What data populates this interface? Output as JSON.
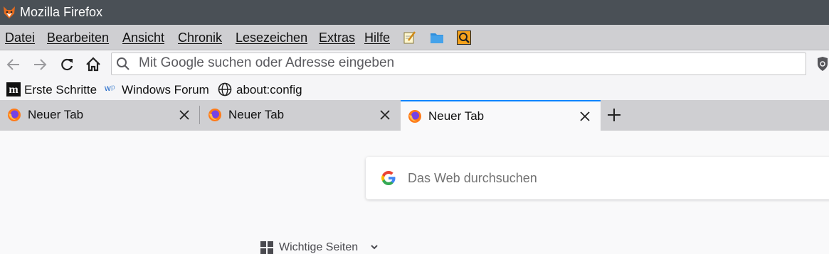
{
  "window": {
    "title": "Mozilla Firefox"
  },
  "menubar": {
    "items": [
      "Datei",
      "Bearbeiten",
      "Ansicht",
      "Chronik",
      "Lesezeichen",
      "Extras",
      "Hilfe"
    ]
  },
  "navbar": {
    "url_placeholder": "Mit Google suchen oder Adresse eingeben"
  },
  "bookmarks": [
    {
      "label": "Erste Schritte",
      "icon": "m-icon"
    },
    {
      "label": "Windows Forum",
      "icon": "wp-icon"
    },
    {
      "label": "about:config",
      "icon": "globe-icon"
    }
  ],
  "tabs": [
    {
      "label": "Neuer Tab",
      "selected": false
    },
    {
      "label": "Neuer Tab",
      "selected": false
    },
    {
      "label": "Neuer Tab",
      "selected": true
    }
  ],
  "newtab_page": {
    "search_placeholder": "Das Web durchsuchen",
    "topsites_label": "Wichtige Seiten"
  },
  "colors": {
    "titlebar": "#4a5056",
    "menubar": "#cfcfd2",
    "selected_tab_accent": "#0a84ff"
  }
}
